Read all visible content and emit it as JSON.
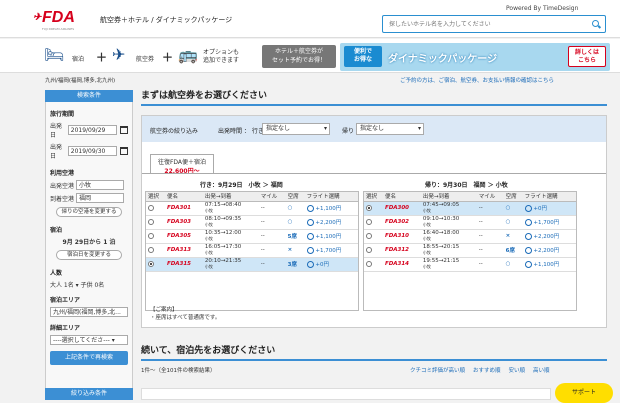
{
  "header": {
    "logo": "FDA",
    "logo_sub": "FUJI DREAM AIRLINES",
    "title": "航空券＋ホテル / ダイナミックパッケージ",
    "powered": "Powered By TimeDesign",
    "search_placeholder": "探したいホテル名を入力してください"
  },
  "steps": {
    "hotel": "宿泊",
    "flight": "航空券",
    "option": "オプションも\n追加できます",
    "set_btn": "ホテル＋航空券が\nセット予約でお得！",
    "banner_l": "便利で\nお得な",
    "banner_main": "ダイナミックパッケージ",
    "banner_r": "詳しくは\nこちら"
  },
  "breadcrumb": "九州/福岡(福岡,博多,北九州)",
  "notice": "ご予約の方は、ご宿泊、航空券、お支払い情報の確認はこちら",
  "sidebar": {
    "header": "検索条件",
    "travel_period": "旅行期間",
    "depart_lbl": "出発日",
    "depart_date": "2019/09/29",
    "return_lbl": "出発日",
    "return_date": "2019/09/30",
    "airport": "利用空港",
    "dep_ap_lbl": "出発空港",
    "dep_ap": "小牧",
    "arr_ap_lbl": "到着空港",
    "arr_ap": "福岡",
    "ret_change": "帰りの空港を変更する",
    "stay": "宿泊",
    "stay_days": "9月 29日から 1 泊",
    "stay_change": "宿泊日を変更する",
    "people": "人数",
    "people_row": "大人 1名 ▾ 子供 0名",
    "area": "宿泊エリア",
    "area_val": "九州/福岡(福岡,博多,北...",
    "detail": "詳細エリア",
    "detail_val": "----選択してくださ--- ▾",
    "search_btn": "上記条件で再検索",
    "filter_hdr": "絞り込み条件"
  },
  "main": {
    "title": "まずは航空券をお選びください",
    "filter_label": "航空券の絞り込み",
    "dep_time": "出発時間 ： 行き",
    "dep_sel": "指定なし",
    "ret_lbl": "帰り",
    "ret_sel": "指定なし",
    "tab_label": "往復FDA便＋宿泊",
    "tab_price": "22,600円〜",
    "out_title": "行き：9月29日　小牧 ＞ 福岡",
    "ret_title": "帰り：9月30日　福岡 ＞ 小牧",
    "cols": [
      "選択",
      "便名",
      "出発→到着",
      "マイル",
      "空席",
      "フライト選購"
    ],
    "outbound": [
      {
        "sel": false,
        "flt": "FDA301",
        "time": "07:15→08:40",
        "sub": "小牧",
        "mile": "--",
        "seat": "○",
        "fare": "+1,100円"
      },
      {
        "sel": false,
        "flt": "FDA303",
        "time": "08:10→09:35",
        "sub": "小牧",
        "mile": "--",
        "seat": "○",
        "fare": "+2,200円"
      },
      {
        "sel": false,
        "flt": "FDA305",
        "time": "10:35→12:00",
        "sub": "小牧",
        "mile": "--",
        "seat": "5席",
        "fare": "+1,100円"
      },
      {
        "sel": false,
        "flt": "FDA313",
        "time": "16:05→17:30",
        "sub": "小牧",
        "mile": "--",
        "seat": "×",
        "fare": "+1,700円"
      },
      {
        "sel": true,
        "flt": "FDA315",
        "time": "20:10→21:35",
        "sub": "小牧",
        "mile": "--",
        "seat": "3席",
        "fare": "+0円"
      }
    ],
    "inbound": [
      {
        "sel": true,
        "flt": "FDA300",
        "time": "07:45→09:05",
        "sub": "小牧",
        "mile": "--",
        "seat": "○",
        "fare": "+0円"
      },
      {
        "sel": false,
        "flt": "FDA302",
        "time": "09:10→10:30",
        "sub": "小牧",
        "mile": "--",
        "seat": "○",
        "fare": "+1,700円"
      },
      {
        "sel": false,
        "flt": "FDA310",
        "time": "16:40→18:00",
        "sub": "小牧",
        "mile": "--",
        "seat": "×",
        "fare": "+2,200円"
      },
      {
        "sel": false,
        "flt": "FDA312",
        "time": "18:55→20:15",
        "sub": "小牧",
        "mile": "--",
        "seat": "6席",
        "fare": "+2,200円"
      },
      {
        "sel": false,
        "flt": "FDA314",
        "time": "19:55→21:15",
        "sub": "小牧",
        "mile": "--",
        "seat": "○",
        "fare": "+1,100円"
      }
    ],
    "notes_title": "【ご案内】",
    "notes": "・座席はすべて普通席です。",
    "title2": "続いて、宿泊先をお選びください",
    "count": "1件〜（全101件の検索結果）",
    "sorts": [
      "クチコミ評価が高い順",
      "おすすめ順",
      "安い順",
      "高い順"
    ],
    "support": "サポート"
  }
}
